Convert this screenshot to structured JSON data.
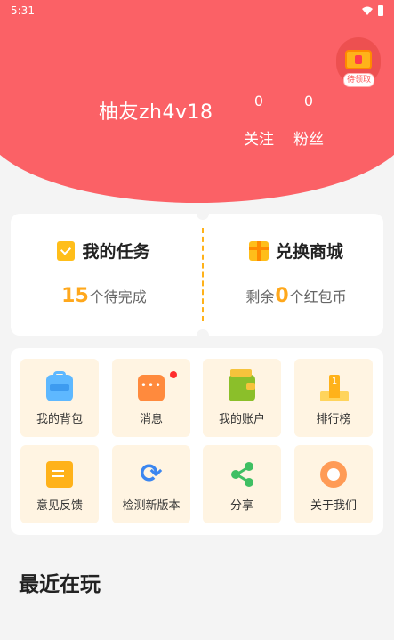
{
  "status_bar": {
    "time": "5:31"
  },
  "profile": {
    "name": "柚友zh4v18"
  },
  "stats": [
    {
      "value": "0",
      "label": "关注"
    },
    {
      "value": "0",
      "label": "粉丝"
    }
  ],
  "reward": {
    "tag": "待领取"
  },
  "tasks": {
    "title": "我的任务",
    "count": "15",
    "suffix": "个待完成"
  },
  "mall": {
    "title": "兑换商城",
    "prefix": "剩余",
    "count": "0",
    "suffix": "个红包币"
  },
  "menu": [
    {
      "label": "我的背包",
      "icon": "backpack-icon"
    },
    {
      "label": "消息",
      "icon": "message-icon"
    },
    {
      "label": "我的账户",
      "icon": "wallet-icon"
    },
    {
      "label": "排行榜",
      "icon": "ranking-icon"
    },
    {
      "label": "意见反馈",
      "icon": "feedback-icon"
    },
    {
      "label": "检测新版本",
      "icon": "update-icon"
    },
    {
      "label": "分享",
      "icon": "share-icon"
    },
    {
      "label": "关于我们",
      "icon": "about-icon"
    }
  ],
  "recent": {
    "title": "最近在玩"
  },
  "colors": {
    "header": "#fb6166",
    "accent": "#ffa81c",
    "tile_bg": "#fff4e2"
  }
}
